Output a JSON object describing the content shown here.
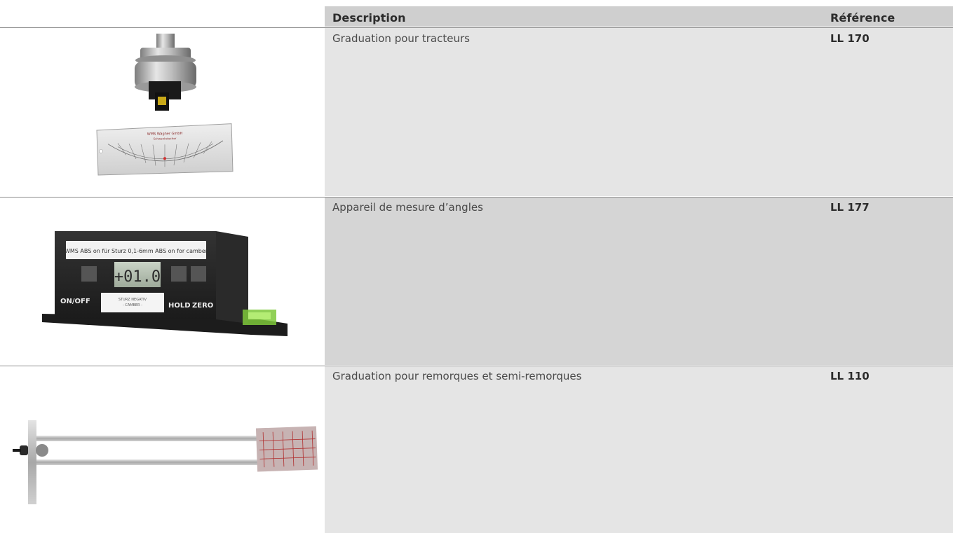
{
  "table": {
    "headers": {
      "description": "Description",
      "reference": "Référence"
    },
    "rows": [
      {
        "description": "Graduation pour tracteurs",
        "reference": "LL 170",
        "image": "tractor-graduation-photo"
      },
      {
        "description": "Appareil de mesure d’angles",
        "reference": "LL 177",
        "image": "angle-meter-photo"
      },
      {
        "description": "Graduation pour remorques et semi-remorques",
        "reference": "LL 110",
        "image": "trailer-graduation-photo"
      }
    ]
  },
  "images": {
    "angle_meter": {
      "label_strip": "WMS ABS on für Sturz 0,1-6mm ABS on for camber",
      "display": "+01.0",
      "btn_onoff": "ON/OFF",
      "btn_hold": "HOLD",
      "btn_zero": "ZERO",
      "center_label_1": "STURZ NEGATIV",
      "center_label_2": "- CAMBER -"
    },
    "tractor_scale": {
      "brand": "WMS Wagner GmbH",
      "sub": "Schwenkstecher"
    }
  },
  "colors": {
    "header_bg": "#cfcfcf",
    "row_bg_1": "#e5e5e5",
    "row_bg_2": "#d5d5d5",
    "row_bg_3": "#e5e5e5",
    "rule": "#8e8e8e"
  }
}
